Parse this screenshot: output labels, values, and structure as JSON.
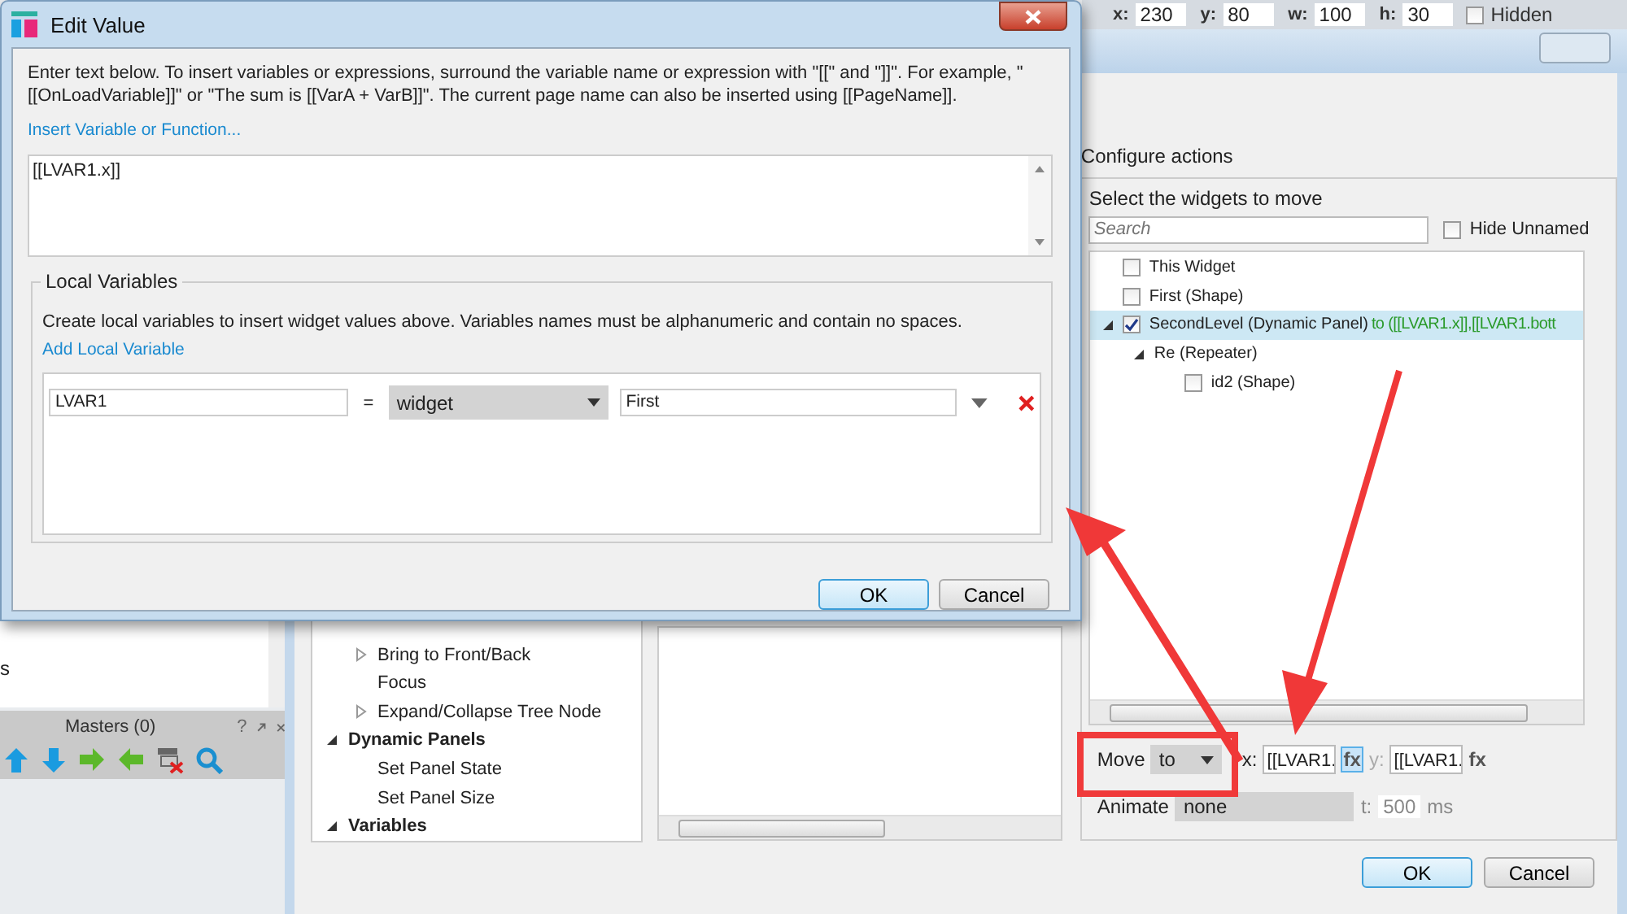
{
  "toolbar": {
    "fields": [
      {
        "label": "x:",
        "value": "230"
      },
      {
        "label": "y:",
        "value": "80"
      },
      {
        "label": "w:",
        "value": "100"
      },
      {
        "label": "h:",
        "value": "30"
      }
    ],
    "hidden": {
      "label": "Hidden",
      "checked": false
    }
  },
  "left_panel": {
    "text": "s"
  },
  "masters_panel": {
    "title": "Masters (0)",
    "help": "?"
  },
  "case_editor": {
    "actions": [
      {
        "kind": "action",
        "label": "Bring to Front/Back",
        "expandable": true,
        "expanded": false
      },
      {
        "kind": "action",
        "label": "Focus",
        "expandable": false
      },
      {
        "kind": "action",
        "label": "Expand/Collapse Tree Node",
        "expandable": true,
        "expanded": false
      },
      {
        "kind": "group",
        "label": "Dynamic Panels",
        "expanded": true,
        "children": [
          {
            "kind": "action",
            "label": "Set Panel State",
            "expandable": false
          },
          {
            "kind": "action",
            "label": "Set Panel Size",
            "expandable": false
          }
        ]
      },
      {
        "kind": "group",
        "label": "Variables",
        "expanded": true
      }
    ],
    "configure": {
      "heading": "Configure actions",
      "prompt": "Select the widgets to move",
      "search": {
        "placeholder": "Search"
      },
      "hide_unnamed": {
        "label": "Hide Unnamed",
        "checked": false
      },
      "widgets": [
        {
          "kind": "checkbox",
          "label": "This Widget",
          "checked": false,
          "selected": false
        },
        {
          "kind": "checkbox",
          "label": "First (Shape)",
          "checked": false,
          "selected": false
        },
        {
          "kind": "checkbox",
          "label": "SecondLevel (Dynamic Panel)",
          "target": "to ([[LVAR1.x]],[[LVAR1.bott",
          "checked": true,
          "selected": true,
          "expanded": true,
          "children": [
            {
              "kind": "group",
              "label": "Re (Repeater)",
              "selected": false,
              "expanded": true,
              "children": [
                {
                  "kind": "checkbox",
                  "label": "id2 (Shape)",
                  "checked": false,
                  "selected": false
                }
              ]
            }
          ]
        }
      ],
      "move": {
        "label": "Move",
        "mode": "to",
        "x_label": "x:",
        "x_value": "[[LVAR1.",
        "x_fx": {
          "label": "fx",
          "focused": true
        },
        "y_label": "y:",
        "y_value": "[[LVAR1.",
        "y_fx": {
          "label": "fx",
          "focused": false
        }
      },
      "animate": {
        "label": "Animate",
        "easing": "none",
        "t_label": "t:",
        "duration": "500",
        "unit": "ms"
      }
    },
    "buttons": [
      {
        "label": "OK",
        "default": true
      },
      {
        "label": "Cancel",
        "default": false
      }
    ]
  },
  "edit_value": {
    "title": "Edit Value",
    "instructions": "Enter text below. To insert variables or expressions, surround the variable name or expression with \"[[\" and \"]]\". For example, \"[[OnLoadVariable]]\" or \"The sum is [[VarA + VarB]]\". The current page name can also be inserted using [[PageName]].",
    "insert_link": "Insert Variable or Function...",
    "expression": "[[LVAR1.x]]",
    "local_variables": {
      "legend": "Local Variables",
      "description": "Create local variables to insert widget values above. Variables names must be alphanumeric and contain no spaces.",
      "add_link": "Add Local Variable",
      "rows": [
        {
          "name": "LVAR1",
          "operator": "=",
          "type": "widget",
          "target": "First"
        }
      ]
    },
    "buttons": [
      {
        "label": "OK",
        "default": true
      },
      {
        "label": "Cancel",
        "default": false
      }
    ]
  }
}
